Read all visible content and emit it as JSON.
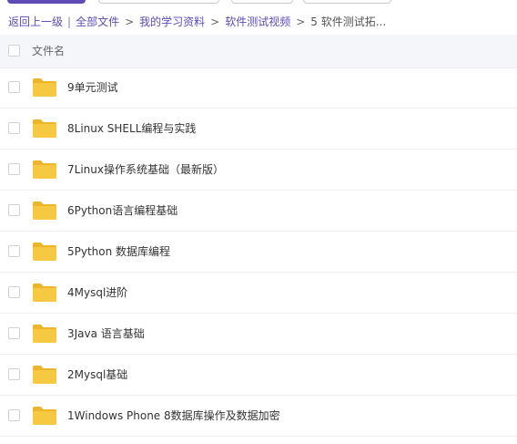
{
  "breadcrumb": {
    "back": "返回上一级",
    "separator": "|",
    "chevron": ">",
    "items": [
      "全部文件",
      "我的学习资料",
      "软件测试视频",
      "5 软件测试拓..."
    ]
  },
  "header": {
    "column_name": "文件名"
  },
  "files": [
    {
      "name": "9单元测试"
    },
    {
      "name": "8Linux SHELL编程与实践"
    },
    {
      "name": "7Linux操作系统基础（最新版）"
    },
    {
      "name": "6Python语言编程基础"
    },
    {
      "name": "5Python 数据库编程"
    },
    {
      "name": "4Mysql进阶"
    },
    {
      "name": "3Java 语言基础"
    },
    {
      "name": "2Mysql基础"
    },
    {
      "name": "1Windows Phone 8数据库操作及数据加密"
    }
  ],
  "colors": {
    "accent": "#5f4ab8",
    "folder": "#f7c842",
    "folder_dark": "#edb52a"
  },
  "icons": {
    "folder": "folder-icon",
    "checkbox": "checkbox-icon"
  }
}
